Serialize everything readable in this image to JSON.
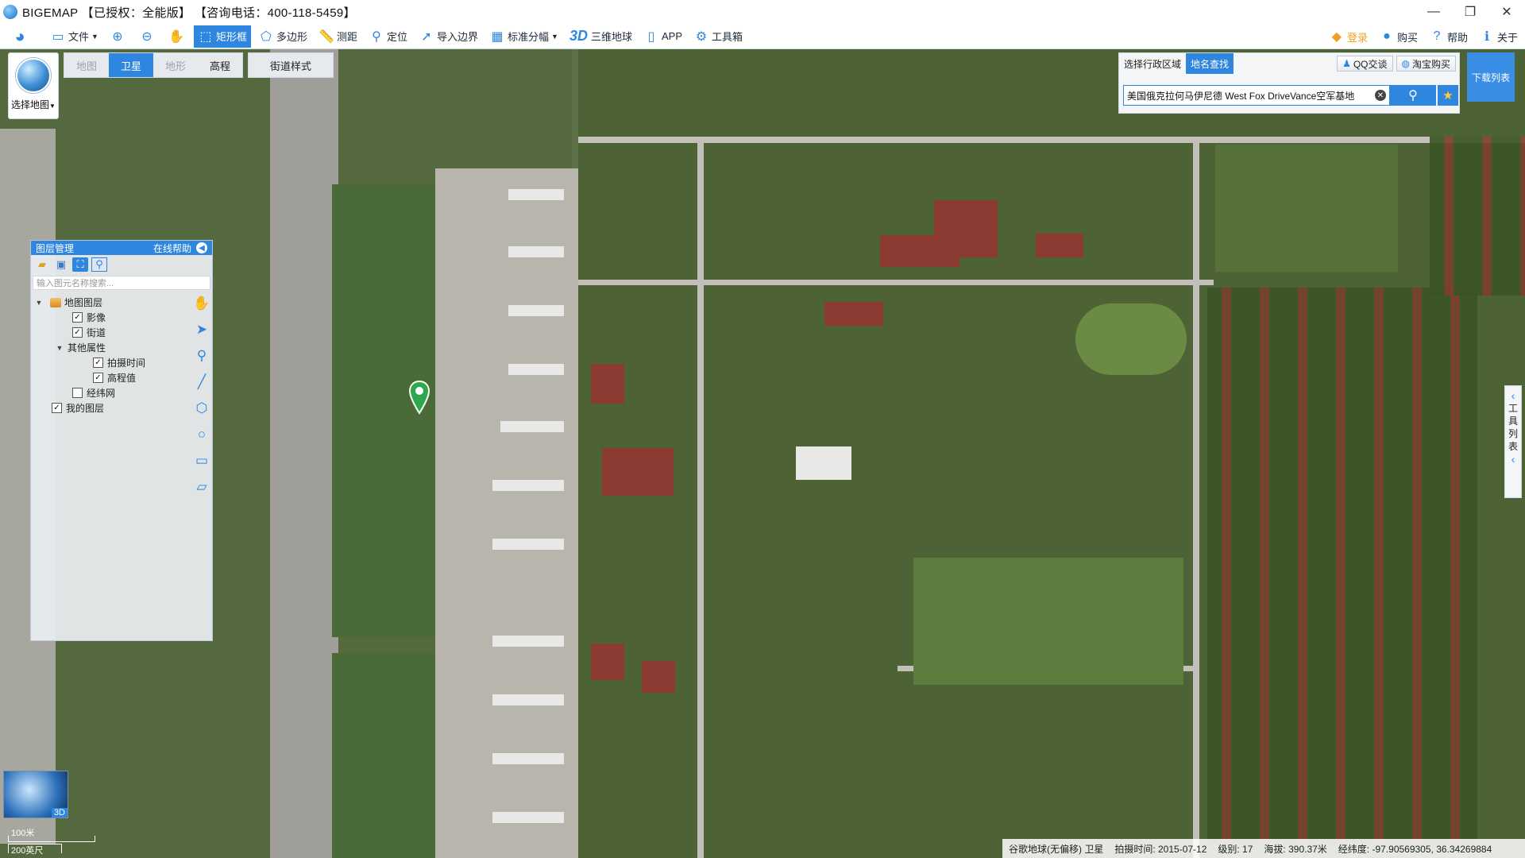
{
  "window": {
    "title": "BIGEMAP 【已授权：全能版】 【咨询电话：400-118-5459】",
    "controls": {
      "minimize": "—",
      "restore": "❐",
      "close": "✕"
    }
  },
  "toolbar": {
    "items": [
      {
        "label": "文件",
        "icon": "folder-icon",
        "dropdown": true
      },
      {
        "label": "",
        "icon": "zoom-in-icon"
      },
      {
        "label": "",
        "icon": "zoom-out-icon"
      },
      {
        "label": "",
        "icon": "hand-pan-icon"
      },
      {
        "label": "矩形框",
        "icon": "rectangle-select-icon",
        "active": true
      },
      {
        "label": "多边形",
        "icon": "polygon-icon"
      },
      {
        "label": "测距",
        "icon": "ruler-icon"
      },
      {
        "label": "定位",
        "icon": "location-pin-icon"
      },
      {
        "label": "导入边界",
        "icon": "import-boundary-icon"
      },
      {
        "label": "标准分幅",
        "icon": "grid-icon",
        "dropdown": true
      },
      {
        "label": "三维地球",
        "icon": "3d-icon"
      },
      {
        "label": "APP",
        "icon": "mobile-icon"
      },
      {
        "label": "工具箱",
        "icon": "gear-icon"
      }
    ],
    "right": [
      {
        "label": "登录",
        "icon": "login-icon"
      },
      {
        "label": "购买",
        "icon": "buy-icon"
      },
      {
        "label": "帮助",
        "icon": "help-icon"
      },
      {
        "label": "关于",
        "icon": "info-icon"
      }
    ],
    "three_d_text": "3D"
  },
  "map_selector": {
    "label": "选择地图"
  },
  "map_tabs": [
    {
      "label": "地图",
      "active": false
    },
    {
      "label": "卫星",
      "active": true
    },
    {
      "label": "地形",
      "active": false
    },
    {
      "label": "高程",
      "active": false
    }
  ],
  "street_style": "街道样式",
  "layer_panel": {
    "title": "图层管理",
    "help": "在线帮助",
    "search_placeholder": "输入图元名称搜索...",
    "tree": {
      "map_layers": {
        "label": "地图图层",
        "children": [
          {
            "label": "影像",
            "checked": true
          },
          {
            "label": "街道",
            "checked": true
          }
        ]
      },
      "other_props": {
        "label": "其他属性",
        "children": [
          {
            "label": "拍摄时间",
            "checked": true
          },
          {
            "label": "高程值",
            "checked": true
          }
        ]
      },
      "graticule": {
        "label": "经纬网",
        "checked": false
      },
      "my_layers": {
        "label": "我的图层",
        "checked": true
      }
    }
  },
  "search_panel": {
    "tabs": [
      {
        "label": "选择行政区域",
        "active": false
      },
      {
        "label": "地名查找",
        "active": true
      }
    ],
    "qq": "QQ交谈",
    "taobao": "淘宝购买",
    "query": "美国俄克拉何马伊尼德 West Fox DriveVance空军基地"
  },
  "download_list": "下载列表",
  "tool_list": [
    "工",
    "具",
    "列",
    "表"
  ],
  "minimap": {
    "tag": "3D"
  },
  "scale": {
    "top": "100米",
    "bottom": "200英尺"
  },
  "status": {
    "source": "谷歌地球(无偏移) 卫星",
    "capture_time": "拍摄时间: 2015-07-12",
    "level": "级别:  17",
    "altitude": "海拔: 390.37米",
    "coords": "经纬度: -97.90569305, 36.34269884"
  },
  "colors": {
    "accent": "#2e86de",
    "panel": "#ebeef2"
  }
}
